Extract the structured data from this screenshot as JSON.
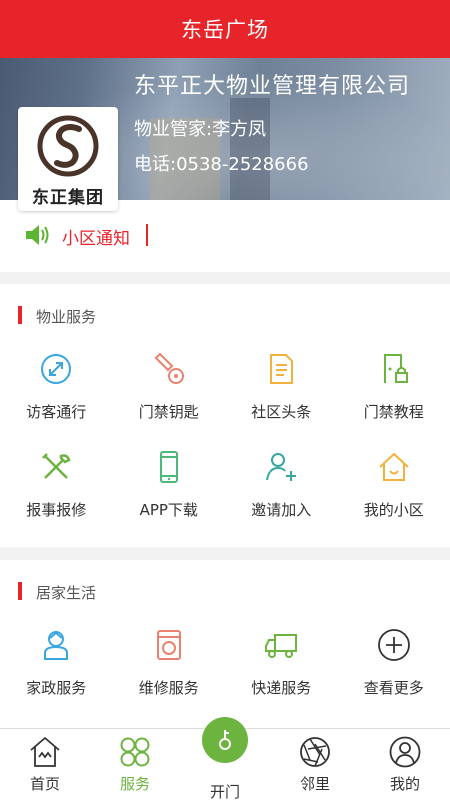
{
  "header": {
    "title": "东岳广场"
  },
  "banner": {
    "company": "东平正大物业管理有限公司",
    "manager": "物业管家:李方凤",
    "phone": "电话:0538-2528666",
    "logo_text": "东正集团"
  },
  "notice": {
    "label": "小区通知",
    "icon": "speaker-icon"
  },
  "property_services": {
    "title": "物业服务",
    "items": [
      {
        "label": "访客通行",
        "icon": "visitor-pass-icon"
      },
      {
        "label": "门禁钥匙",
        "icon": "key-icon"
      },
      {
        "label": "社区头条",
        "icon": "document-icon"
      },
      {
        "label": "门禁教程",
        "icon": "door-lock-icon"
      },
      {
        "label": "报事报修",
        "icon": "tools-icon"
      },
      {
        "label": "APP下载",
        "icon": "phone-icon"
      },
      {
        "label": "邀请加入",
        "icon": "add-user-icon"
      },
      {
        "label": "我的小区",
        "icon": "home-icon"
      }
    ]
  },
  "home_life": {
    "title": "居家生活",
    "items": [
      {
        "label": "家政服务",
        "icon": "housekeeper-icon"
      },
      {
        "label": "维修服务",
        "icon": "washing-machine-icon"
      },
      {
        "label": "快递服务",
        "icon": "delivery-truck-icon"
      },
      {
        "label": "查看更多",
        "icon": "plus-circle-icon"
      }
    ]
  },
  "tabbar": {
    "tabs": [
      {
        "label": "首页",
        "icon": "house-icon"
      },
      {
        "label": "服务",
        "icon": "grid-services-icon",
        "active": true
      },
      {
        "label": "开门",
        "icon": "open-door-icon"
      },
      {
        "label": "邻里",
        "icon": "aperture-icon"
      },
      {
        "label": "我的",
        "icon": "user-circle-icon"
      }
    ]
  },
  "colors": {
    "brand_red": "#e8242b",
    "active_green": "#6db33f"
  }
}
